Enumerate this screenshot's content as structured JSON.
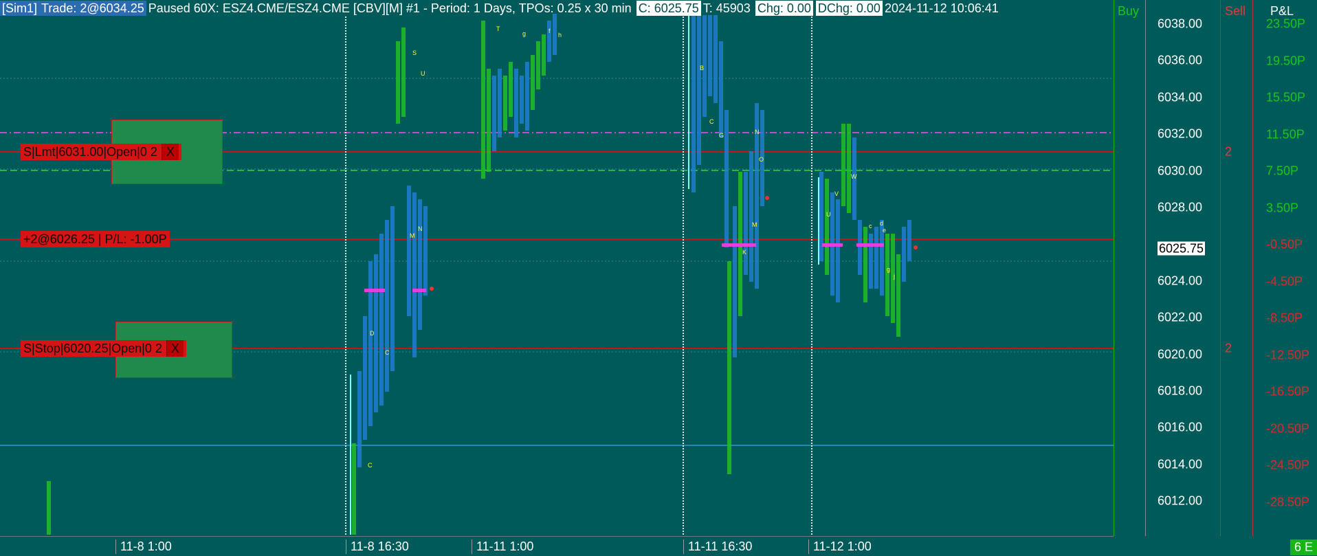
{
  "header": {
    "sim_tag": "[Sim1]",
    "trade": "Trade: 2@6034.25",
    "title": "Paused 60X: ESZ4.CME/ESZ4.CME [CBV][M] #1 - Period: 1 Days, TPOs: 0.25 x 30 min",
    "close": "C: 6025.75",
    "ticks": "T: 45903",
    "chg": "Chg: 0.00",
    "dchg": "DChg: 0.00",
    "datetime": "2024-11-12 10:06:41"
  },
  "columns": {
    "buy": "Buy",
    "sell": "Sell",
    "pl": "P&L"
  },
  "orders": {
    "limit": "S|Lmt|6031.00|Open|0  2",
    "limit_close": "X",
    "position": "+2@6026.25 | P/L: -1.00P",
    "stop": "S|Stop|6020.25|Open|0  2",
    "stop_close": "X"
  },
  "sell_counts": {
    "limit": "2",
    "stop": "2"
  },
  "price_axis": {
    "labels": [
      "6038.00",
      "6036.00",
      "6034.00",
      "6032.00",
      "6030.00",
      "6028.00",
      "6024.00",
      "6022.00",
      "6020.00",
      "6018.00",
      "6016.00",
      "6014.00",
      "6012.00"
    ],
    "current": "6025.75"
  },
  "pl_axis": [
    "23.50P",
    "19.50P",
    "15.50P",
    "11.50P",
    "7.50P",
    "3.50P",
    "-0.50P",
    "-4.50P",
    "-8.50P",
    "-12.50P",
    "-16.50P",
    "-20.50P",
    "-24.50P",
    "-28.50P"
  ],
  "time_axis": [
    "11-8  1:00",
    "11-8  16:30",
    "11-11  1:00",
    "11-11  16:30",
    "11-12  1:00"
  ],
  "badge": "6 E",
  "colors": {
    "background": "#005a5a",
    "tpo_blue": "#1e7fd0",
    "tpo_green": "#22c022",
    "tpo_yellow": "#ffff33",
    "order_red": "#d61414",
    "box_green": "#1f8a4c"
  }
}
